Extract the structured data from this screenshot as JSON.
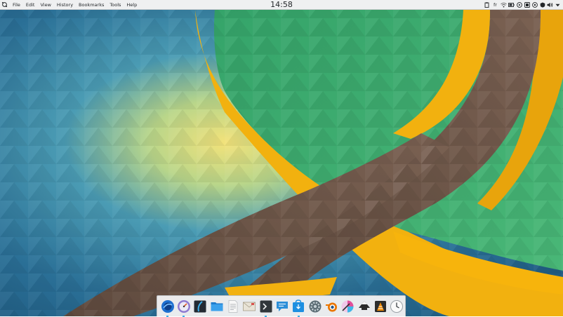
{
  "menubar": {
    "launcher_icon": "kde-logo-icon",
    "items": [
      "File",
      "Edit",
      "View",
      "History",
      "Bookmarks",
      "Tools",
      "Help"
    ]
  },
  "clock": {
    "time": "14:58"
  },
  "tray": {
    "keyboard_layout": "fr",
    "icons": [
      "clipboard-icon",
      "network-wifi-icon",
      "battery-icon",
      "media-player-icon",
      "device-notifier-icon",
      "vault-icon",
      "updates-icon",
      "volume-icon",
      "tray-expand-icon"
    ]
  },
  "dock": {
    "apps": [
      {
        "name": "app-launcher-icon",
        "running": true
      },
      {
        "name": "system-monitor-icon",
        "running": true
      },
      {
        "name": "konsole-dark-icon",
        "running": false
      },
      {
        "name": "folder-icon",
        "running": false
      },
      {
        "name": "document-icon",
        "running": false
      },
      {
        "name": "mail-icon",
        "running": false
      },
      {
        "name": "terminal-icon",
        "running": true
      },
      {
        "name": "chat-icon",
        "running": false
      },
      {
        "name": "software-center-icon",
        "running": true
      },
      {
        "name": "settings-icon",
        "running": false
      },
      {
        "name": "blender-icon",
        "running": false
      },
      {
        "name": "color-picker-icon",
        "running": false
      },
      {
        "name": "inkscape-icon",
        "running": false
      },
      {
        "name": "vlc-icon",
        "running": false
      },
      {
        "name": "clock-icon",
        "running": false
      }
    ]
  },
  "colors": {
    "panel": "#eff0f1",
    "accent": "#3daee9",
    "grass": "#3fae6e",
    "road": "#6b5548",
    "gold": "#f2b10f",
    "water": "#2f86a8"
  }
}
